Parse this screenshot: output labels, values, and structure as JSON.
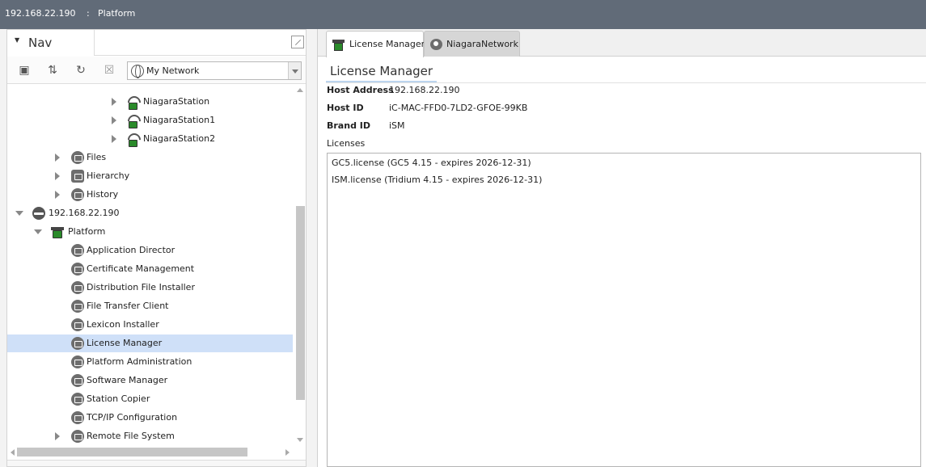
{
  "titlebar": {
    "host": "192.168.22.190",
    "separator": ":",
    "crumb": "Platform"
  },
  "nav": {
    "title": "Nav",
    "network_select": "My Network",
    "tree": [
      {
        "label": "NiagaraStation",
        "icon": "station-icon"
      },
      {
        "label": "NiagaraStation1",
        "icon": "station-icon"
      },
      {
        "label": "NiagaraStation2",
        "icon": "station-icon"
      },
      {
        "label": "Files",
        "icon": "files-icon"
      },
      {
        "label": "Hierarchy",
        "icon": "hierarchy-icon"
      },
      {
        "label": "History",
        "icon": "history-icon"
      },
      {
        "label": "192.168.22.190",
        "icon": "host-icon"
      },
      {
        "label": "Platform",
        "icon": "platform-icon"
      },
      {
        "label": "Application Director",
        "icon": "service-icon"
      },
      {
        "label": "Certificate Management",
        "icon": "service-icon"
      },
      {
        "label": "Distribution File Installer",
        "icon": "service-icon"
      },
      {
        "label": "File Transfer Client",
        "icon": "service-icon"
      },
      {
        "label": "Lexicon Installer",
        "icon": "service-icon"
      },
      {
        "label": "License Manager",
        "icon": "service-icon"
      },
      {
        "label": "Platform Administration",
        "icon": "service-icon"
      },
      {
        "label": "Software Manager",
        "icon": "service-icon"
      },
      {
        "label": "Station Copier",
        "icon": "service-icon"
      },
      {
        "label": "TCP/IP Configuration",
        "icon": "service-icon"
      },
      {
        "label": "Remote File System",
        "icon": "service-icon"
      }
    ]
  },
  "tabs": [
    {
      "label": "License Manager",
      "icon": "platform-icon"
    },
    {
      "label": "NiagaraNetwork",
      "icon": "network-icon"
    }
  ],
  "view": {
    "title": "License Manager",
    "host_address_label": "Host Address",
    "host_address": "192.168.22.190",
    "host_id_label": "Host ID",
    "host_id": "iC-MAC-FFD0-7LD2-GFOE-99KB",
    "brand_id_label": "Brand ID",
    "brand_id": "iSM",
    "licenses_label": "Licenses",
    "licenses": [
      "GC5.license (GC5 4.15 - expires 2026-12-31)",
      "ISM.license (Tridium 4.15 - expires 2026-12-31)"
    ]
  },
  "colors": {
    "titlebar": "#616b78",
    "selection": "#cfe0f8",
    "station_green": "#2a8a2a"
  }
}
